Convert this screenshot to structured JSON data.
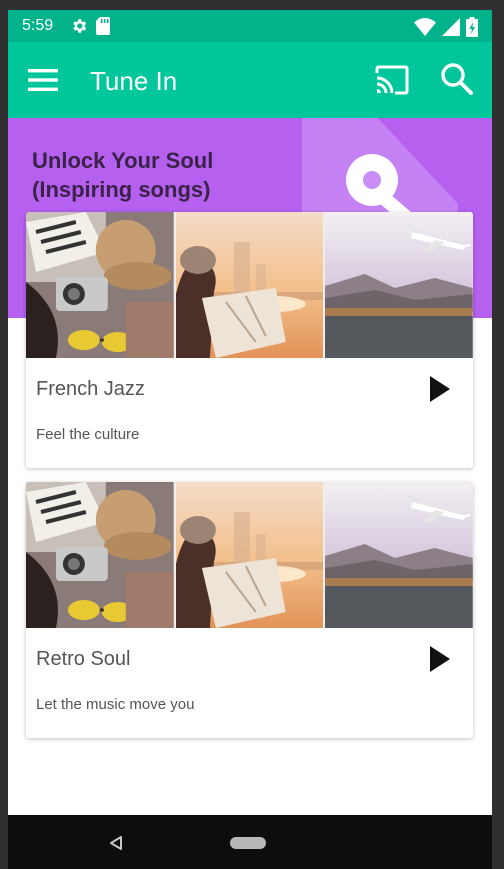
{
  "status_bar": {
    "time": "5:59",
    "icons": [
      "gear-icon",
      "sd-card-icon",
      "wifi-icon",
      "signal-icon",
      "battery-icon"
    ]
  },
  "app_bar": {
    "title": "Tune In",
    "icons": [
      "menu-icon",
      "cast-icon",
      "search-icon"
    ],
    "color": "#00c79b"
  },
  "hero": {
    "title_line1": "Unlock Your Soul",
    "title_line2": "(Inspiring songs)",
    "color": "#b660f0",
    "icon": "key-icon"
  },
  "playlists": [
    {
      "title": "French Jazz",
      "subtitle": "Feel the culture",
      "photos": [
        "travel-items-photo",
        "woman-with-map-photo",
        "airplane-over-lake-photo"
      ],
      "action_icon": "play-icon"
    },
    {
      "title": "Retro Soul",
      "subtitle": "Let the music move you",
      "photos": [
        "travel-items-photo",
        "woman-with-map-photo",
        "airplane-over-lake-photo"
      ],
      "action_icon": "play-icon"
    }
  ],
  "nav_bar": {
    "icons": [
      "back-icon",
      "home-icon"
    ]
  }
}
